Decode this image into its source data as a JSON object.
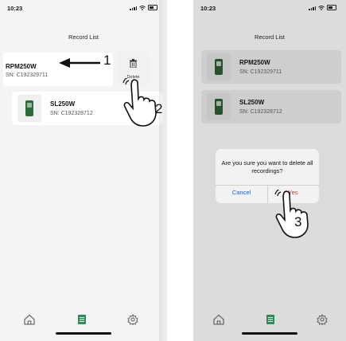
{
  "left_screen": {
    "status_time": "10:23",
    "title": "Record List",
    "items": [
      {
        "name": "RPM250W",
        "sn": "SN: C192329711"
      },
      {
        "name": "SL250W",
        "sn": "SN: C192328712"
      }
    ],
    "delete_label": "Delete",
    "annotation_1": "1",
    "annotation_2": "2"
  },
  "right_screen": {
    "status_time": "10:23",
    "title": "Record List",
    "items": [
      {
        "name": "RPM250W",
        "sn": "SN: C192329711"
      },
      {
        "name": "SL250W",
        "sn": "SN: C192328712"
      }
    ],
    "dialog": {
      "message": "Are you sure you want to delete all recordings?",
      "cancel": "Cancel",
      "yes": "Yes"
    },
    "annotation_3": "3"
  },
  "tabs": [
    "home-icon",
    "list-icon",
    "settings-icon"
  ],
  "colors": {
    "accent": "#2e8b57",
    "destructive": "#d9363e",
    "cancel": "#2a5db0",
    "device": "#2d6b38"
  }
}
